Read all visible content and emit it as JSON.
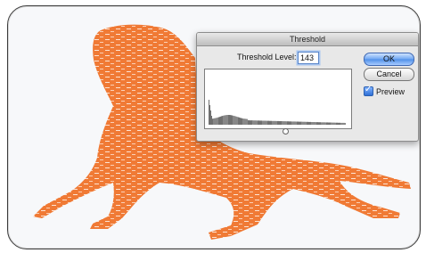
{
  "dialog": {
    "title": "Threshold",
    "threshold_label": "Threshold Level:",
    "threshold_value": "143",
    "ok_label": "OK",
    "cancel_label": "Cancel",
    "preview_label": "Preview",
    "preview_checked": true
  },
  "colors": {
    "lizard_orange": "#F07A35",
    "ok_blue": "#4F8FE8"
  }
}
